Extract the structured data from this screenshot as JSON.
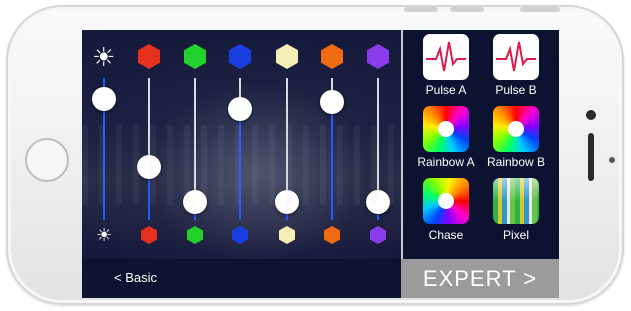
{
  "colors": {
    "red": "#e5301b",
    "green": "#22d12c",
    "blue": "#1a3fe0",
    "cream": "#f4efb6",
    "orange": "#f06a12",
    "purple": "#8a3bea"
  },
  "brightness": {
    "max_icon": "sun-icon",
    "min_icon": "sun-small-icon",
    "level": 0.85
  },
  "channels": [
    {
      "name": "red",
      "level": 0.37
    },
    {
      "name": "green",
      "level": 0.13
    },
    {
      "name": "blue",
      "level": 0.78
    },
    {
      "name": "cream",
      "level": 0.13
    },
    {
      "name": "orange",
      "level": 0.83
    },
    {
      "name": "purple",
      "level": 0.13
    }
  ],
  "effects": [
    {
      "label": "Pulse A",
      "icon": "pulse-icon"
    },
    {
      "label": "Pulse B",
      "icon": "pulse-icon"
    },
    {
      "label": "Rainbow A",
      "icon": "color-wheel-icon"
    },
    {
      "label": "Rainbow B",
      "icon": "color-wheel-icon"
    },
    {
      "label": "Chase",
      "icon": "color-wheel-icon"
    },
    {
      "label": "Pixel",
      "icon": "pixel-mosaic-icon"
    }
  ],
  "bottom_bar": {
    "basic_label": "<  Basic",
    "expert_label": "EXPERT >"
  }
}
